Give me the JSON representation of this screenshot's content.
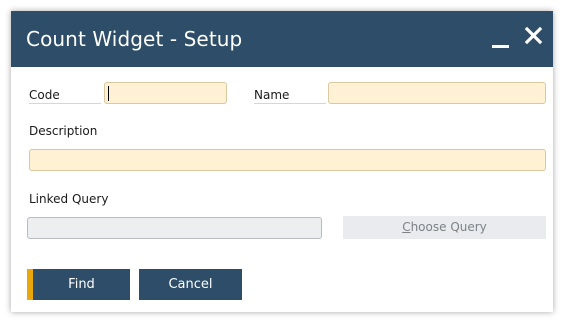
{
  "window": {
    "title": "Count Widget - Setup"
  },
  "form": {
    "code_label": "Code",
    "code_value": "",
    "name_label": "Name",
    "name_value": "",
    "description_label": "Description",
    "description_value": "",
    "linked_query_label": "Linked Query",
    "linked_query_value": "",
    "choose_query_first_letter": "C",
    "choose_query_rest": "hoose Query"
  },
  "footer": {
    "find_label": "Find",
    "cancel_label": "Cancel"
  },
  "colors": {
    "titlebar": "#2d4d68",
    "accent": "#e8a70b",
    "field": "#fff2d4"
  },
  "icons": {
    "minimize": "minimize-icon",
    "close": "close-icon"
  }
}
